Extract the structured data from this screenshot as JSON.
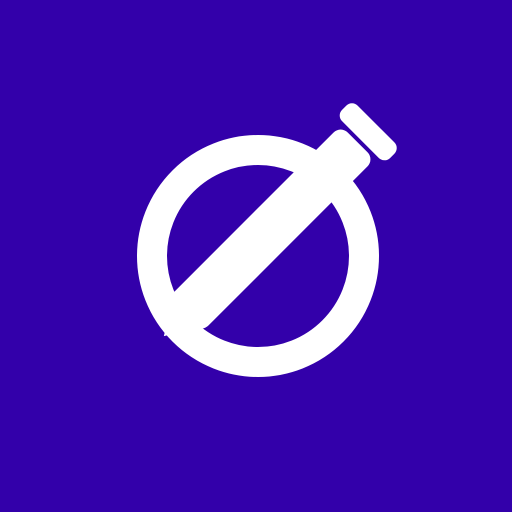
{
  "app_icon": {
    "icon_name": "circle-with-pen-slash-icon",
    "background_color": "#3300aa",
    "foreground_color": "#ffffff"
  }
}
